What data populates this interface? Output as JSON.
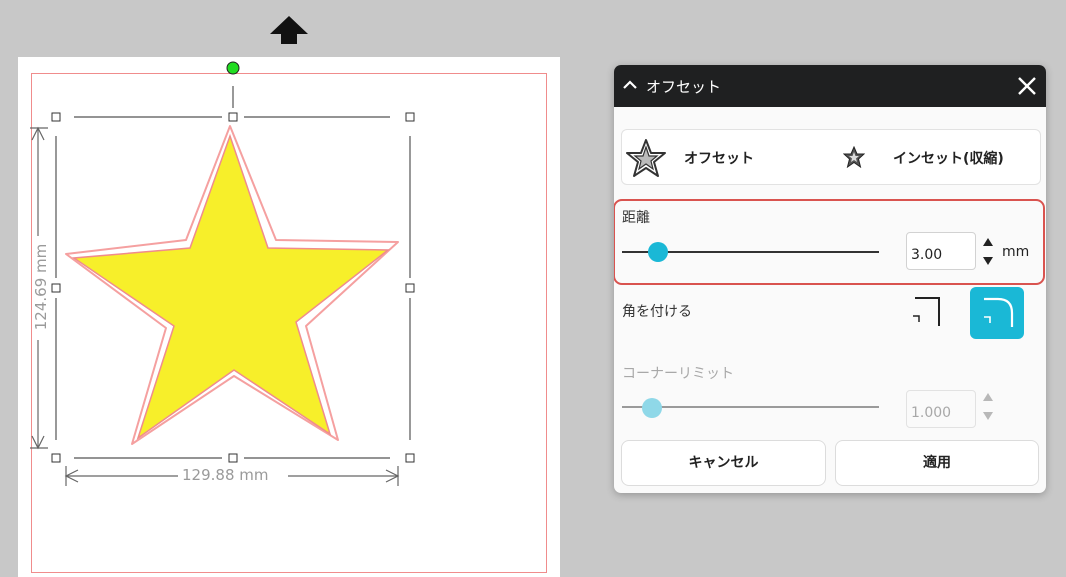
{
  "canvas": {
    "width_label": "129.88 mm",
    "height_label": "124.69 mm",
    "star_fill": "#f7ef2a",
    "offset_line_color": "#f5a0a0",
    "mat_border_color": "#f08c8c",
    "rotate_handle_color": "#22dd22"
  },
  "panel": {
    "title": "オフセット",
    "modes": {
      "offset_label": "オフセット",
      "inset_label": "インセット(収縮)"
    },
    "distance": {
      "label": "距離",
      "value": "3.00",
      "unit": "mm"
    },
    "corner": {
      "label": "角を付ける",
      "options": [
        "sharp",
        "rounded"
      ],
      "selected": "rounded"
    },
    "corner_limit": {
      "label": "コーナーリミット",
      "value": "1.000"
    },
    "buttons": {
      "cancel": "キャンセル",
      "apply": "適用"
    },
    "accent_color": "#1ab8d6",
    "highlight_color": "#d9534f"
  }
}
